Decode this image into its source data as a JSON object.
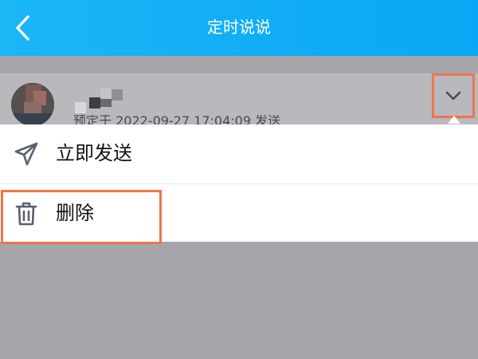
{
  "header": {
    "title": "定时说说",
    "back_icon": "chevron-left-icon"
  },
  "post": {
    "meta": "预定于 2022-09-27 17:04:09 发送",
    "dropdown_icon": "chevron-down-icon"
  },
  "menu": {
    "items": [
      {
        "label": "立即发送",
        "icon": "paper-plane-icon"
      },
      {
        "label": "删除",
        "icon": "trash-icon"
      }
    ]
  },
  "colors": {
    "header": "#09a7f5",
    "overlay": "#a6a5aa",
    "highlight": "#f0744a",
    "menu_bg": "#ffffff"
  }
}
